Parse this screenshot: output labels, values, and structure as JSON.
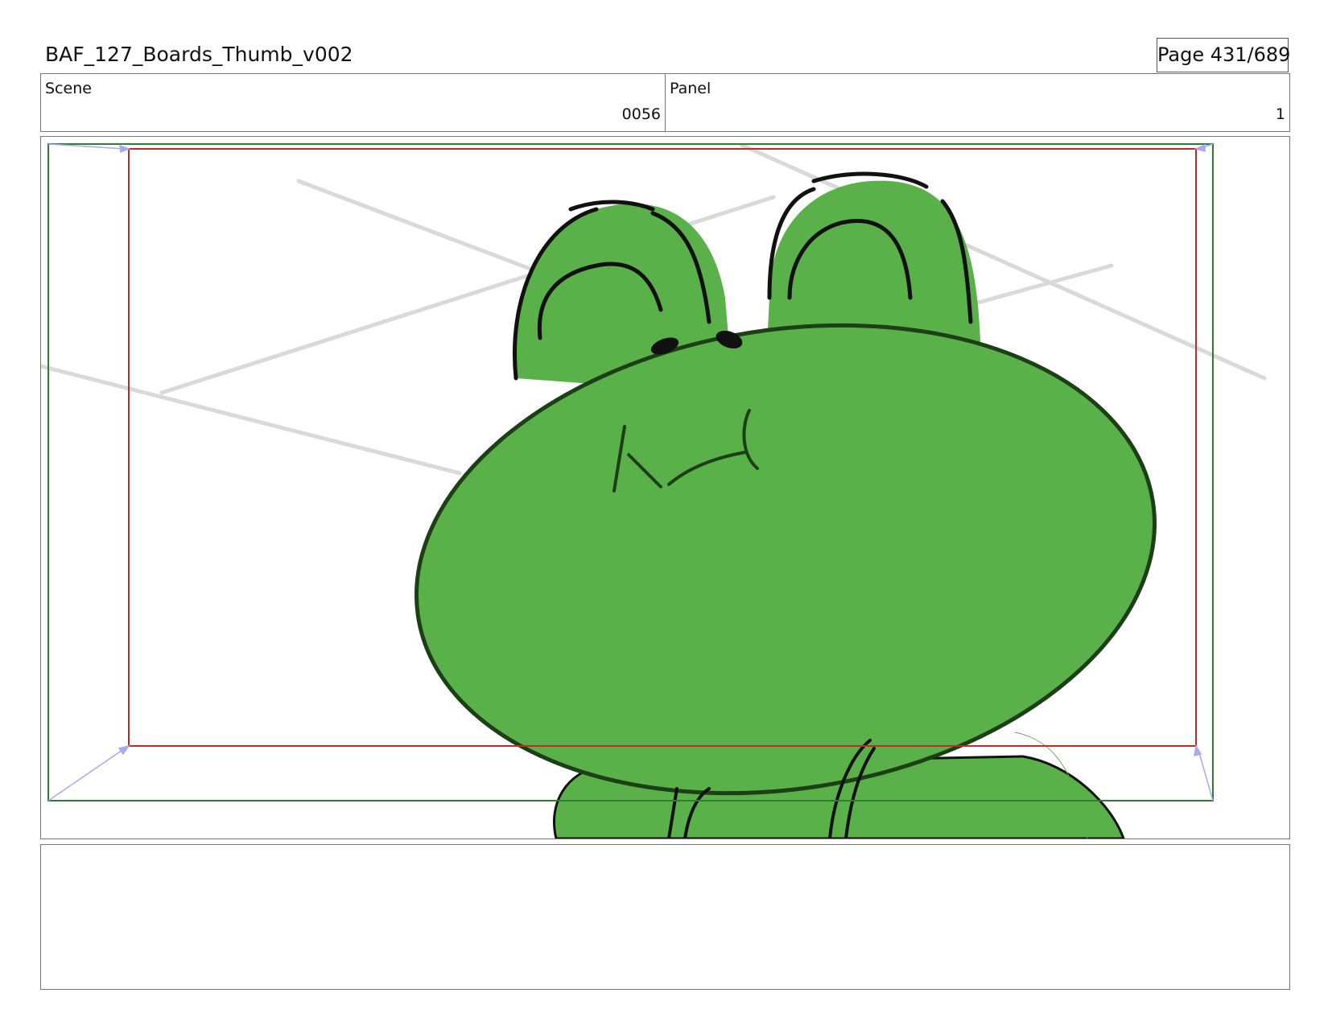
{
  "document": {
    "title": "BAF_127_Boards_Thumb_v002",
    "page_label": "Page 431/689"
  },
  "header": {
    "scene": {
      "label": "Scene",
      "value": "0056"
    },
    "panel": {
      "label": "Panel",
      "value": "1"
    }
  },
  "frame": {
    "safe_area_color": "#2e7d32",
    "action_area_color": "#c62828",
    "camera_move_arrow_color": "#a9a9f0",
    "character_fill": "#5ab14a",
    "character_line": "#111111"
  },
  "notes": {
    "text": ""
  }
}
